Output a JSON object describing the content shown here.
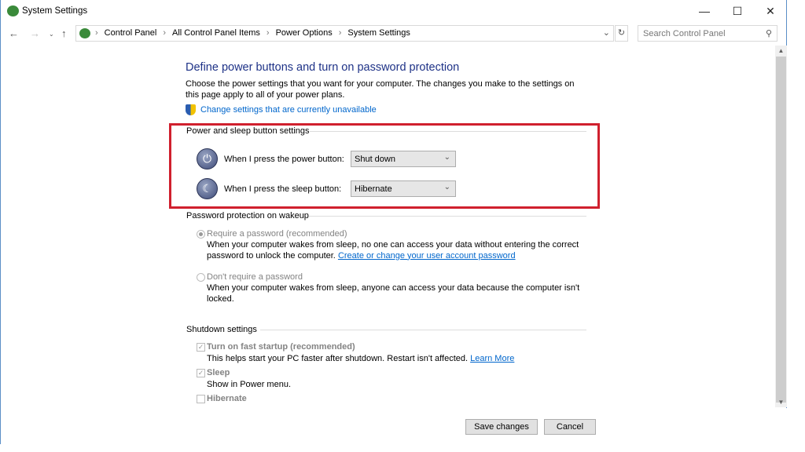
{
  "window": {
    "title": "System Settings"
  },
  "address": {
    "crumbs": [
      "Control Panel",
      "All Control Panel Items",
      "Power Options",
      "System Settings"
    ],
    "search_placeholder": "Search Control Panel"
  },
  "page": {
    "title": "Define power buttons and turn on password protection",
    "description": "Choose the power settings that you want for your computer. The changes you make to the settings on this page apply to all of your power plans.",
    "change_link": "Change settings that are currently unavailable"
  },
  "power_sleep": {
    "heading": "Power and sleep button settings",
    "power_label": "When I press the power button:",
    "power_value": "Shut down",
    "sleep_label": "When I press the sleep button:",
    "sleep_value": "Hibernate",
    "highlight_color": "#d0202e"
  },
  "password": {
    "heading": "Password protection on wakeup",
    "require_label": "Require a password (recommended)",
    "require_desc": "When your computer wakes from sleep, no one can access your data without entering the correct password to unlock the computer.",
    "require_link": "Create or change your user account password",
    "norequire_label": "Don't require a password",
    "norequire_desc": "When your computer wakes from sleep, anyone can access your data because the computer isn't locked."
  },
  "shutdown": {
    "heading": "Shutdown settings",
    "fast_label": "Turn on fast startup (recommended)",
    "fast_desc": "This helps start your PC faster after shutdown. Restart isn't affected.",
    "fast_link": "Learn More",
    "sleep_label": "Sleep",
    "sleep_desc": "Show in Power menu.",
    "hibernate_label": "Hibernate"
  },
  "footer": {
    "save": "Save changes",
    "cancel": "Cancel"
  }
}
